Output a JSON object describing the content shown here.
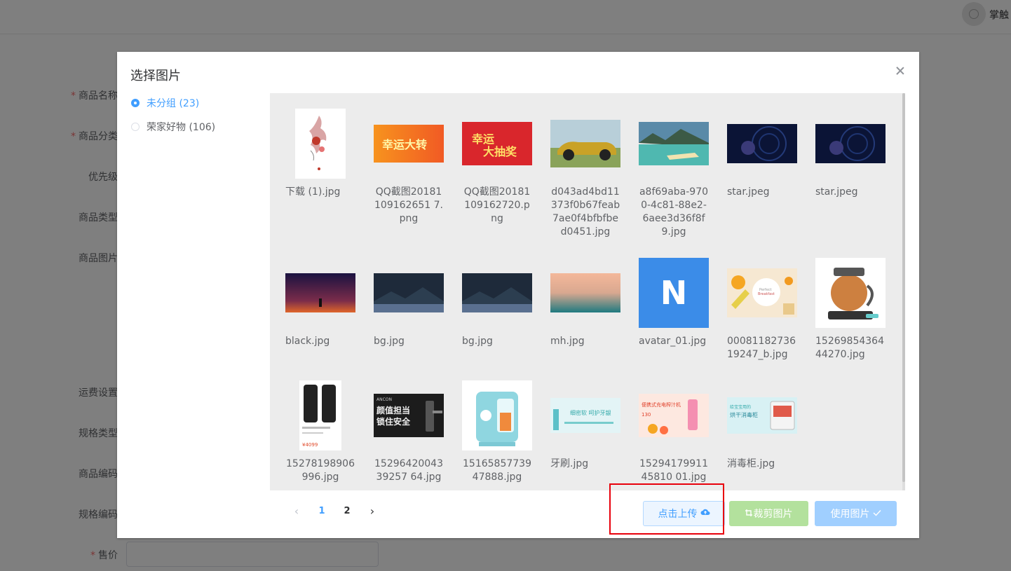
{
  "header": {
    "username": "掌触"
  },
  "form": {
    "labels": [
      {
        "text": "商品名称",
        "required": true
      },
      {
        "text": "商品分类",
        "required": true
      },
      {
        "text": "优先级",
        "required": false
      },
      {
        "text": "商品类型",
        "required": false
      },
      {
        "text": "商品图片",
        "required": false
      },
      {
        "text": "运费设置",
        "required": false
      },
      {
        "text": "规格类型",
        "required": false
      },
      {
        "text": "商品编码",
        "required": false
      },
      {
        "text": "规格编码",
        "required": false
      },
      {
        "text": "售价",
        "required": true
      }
    ],
    "required_mark": "*"
  },
  "dialog": {
    "title": "选择图片",
    "groups": [
      {
        "label": "未分组 (23)",
        "checked": true
      },
      {
        "label": "荣家好物 (106)",
        "checked": false
      }
    ],
    "images": [
      {
        "name": "下载 (1).jpg"
      },
      {
        "name": "QQ截图20181109162651 7.png"
      },
      {
        "name": "QQ截图20181109162720.png"
      },
      {
        "name": "d043ad4bd11373f0b67feab7ae0f4bfbfbed0451.jpg"
      },
      {
        "name": "a8f69aba-9700-4c81-88e2-6aee3d36f8f9.jpg"
      },
      {
        "name": "star.jpeg"
      },
      {
        "name": "star.jpeg"
      },
      {
        "name": "black.jpg"
      },
      {
        "name": "bg.jpg"
      },
      {
        "name": "bg.jpg"
      },
      {
        "name": "mh.jpg"
      },
      {
        "name": "avatar_01.jpg",
        "letter": "N"
      },
      {
        "name": "0008118273619247_b.jpg",
        "card_lines": [
          "Perfect",
          "Breakfast"
        ]
      },
      {
        "name": "1526985436444270.jpg"
      },
      {
        "name": "15278198906996.jpg",
        "price": "¥4099"
      },
      {
        "name": "1529642004339257 64.jpg",
        "brand": "ANCON",
        "lines": [
          "颜值担当",
          "锁住安全"
        ]
      },
      {
        "name": "1516585773947888.jpg"
      },
      {
        "name": "牙刷.jpg",
        "banner": "细密软 呵护牙龈"
      },
      {
        "name": "1529417991145810 01.jpg",
        "banner": "便携式充电榨汁机",
        "price": "130"
      },
      {
        "name": "消毒柜.jpg",
        "banner_lines": [
          "给宝宝用的",
          "烘干消毒柜"
        ]
      }
    ],
    "pagination": {
      "prev": "‹",
      "next": "›",
      "pages": [
        "1",
        "2"
      ],
      "current": "1"
    },
    "buttons": {
      "upload": "点击上传",
      "crop": "裁剪图片",
      "use": "使用图片"
    },
    "colors": {
      "primary": "#409eff",
      "success_light": "#b3e19d",
      "primary_light": "#a0cfff",
      "highlight": "#e8000b"
    }
  }
}
